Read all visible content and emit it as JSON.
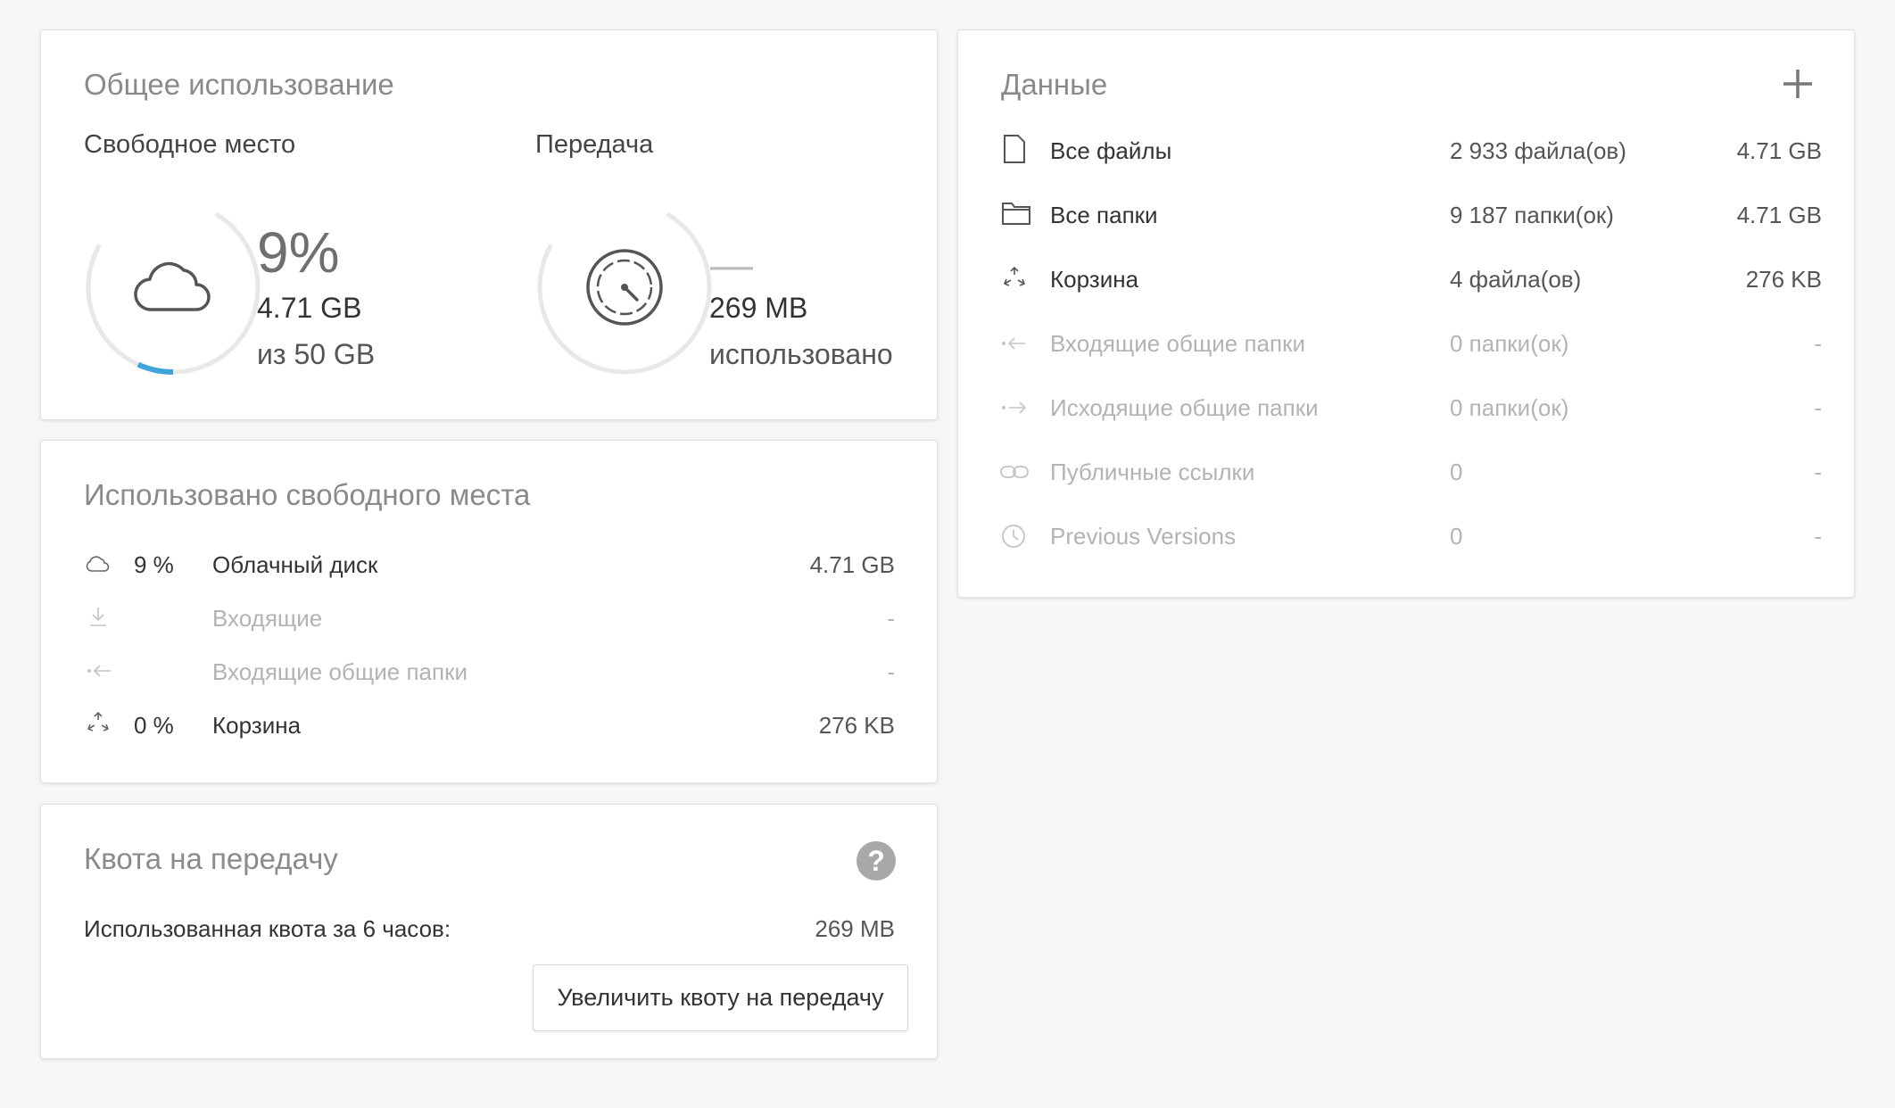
{
  "overall": {
    "title": "Общее использование",
    "storage": {
      "label": "Свободное место",
      "percent_text": "9%",
      "used": "4.71 GB",
      "total": "из 50 GB",
      "fraction": 0.09,
      "accent_color": "#3ea4dc"
    },
    "transfer": {
      "label": "Передача",
      "dash": "—",
      "used": "269 MB",
      "caption": "использовано"
    }
  },
  "space_used": {
    "title": "Использовано свободного места",
    "rows": [
      {
        "icon": "cloud-icon",
        "percent": "9 %",
        "label": "Облачный диск",
        "value": "4.71 GB",
        "dim": false
      },
      {
        "icon": "download-icon",
        "percent": "",
        "label": "Входящие",
        "value": "-",
        "dim": true
      },
      {
        "icon": "incoming-share-icon",
        "percent": "",
        "label": "Входящие общие папки",
        "value": "-",
        "dim": true
      },
      {
        "icon": "recycle-icon",
        "percent": "0 %",
        "label": "Корзина",
        "value": "276 KB",
        "dim": false
      }
    ]
  },
  "quota": {
    "title": "Квота на передачу",
    "help_symbol": "?",
    "used_label": "Использованная квота за 6 часов:",
    "used_value": "269 MB",
    "button_label": "Увеличить квоту на передачу"
  },
  "data": {
    "title": "Данные",
    "add_symbol": "+",
    "rows": [
      {
        "icon": "file-icon",
        "label": "Все файлы",
        "count": "2 933 файла(ов)",
        "size": "4.71 GB",
        "dim": false
      },
      {
        "icon": "folder-icon",
        "label": "Все папки",
        "count": "9 187 папки(ок)",
        "size": "4.71 GB",
        "dim": false
      },
      {
        "icon": "recycle-icon",
        "label": "Корзина",
        "count": "4 файла(ов)",
        "size": "276 KB",
        "dim": false
      },
      {
        "icon": "incoming-share-icon",
        "label": "Входящие общие папки",
        "count": "0 папки(ок)",
        "size": "-",
        "dim": true
      },
      {
        "icon": "outgoing-share-icon",
        "label": "Исходящие общие папки",
        "count": "0 папки(ок)",
        "size": "-",
        "dim": true
      },
      {
        "icon": "link-icon",
        "label": "Публичные ссылки",
        "count": "0",
        "size": "-",
        "dim": true
      },
      {
        "icon": "clock-icon",
        "label": "Previous Versions",
        "count": "0",
        "size": "-",
        "dim": true
      }
    ]
  }
}
